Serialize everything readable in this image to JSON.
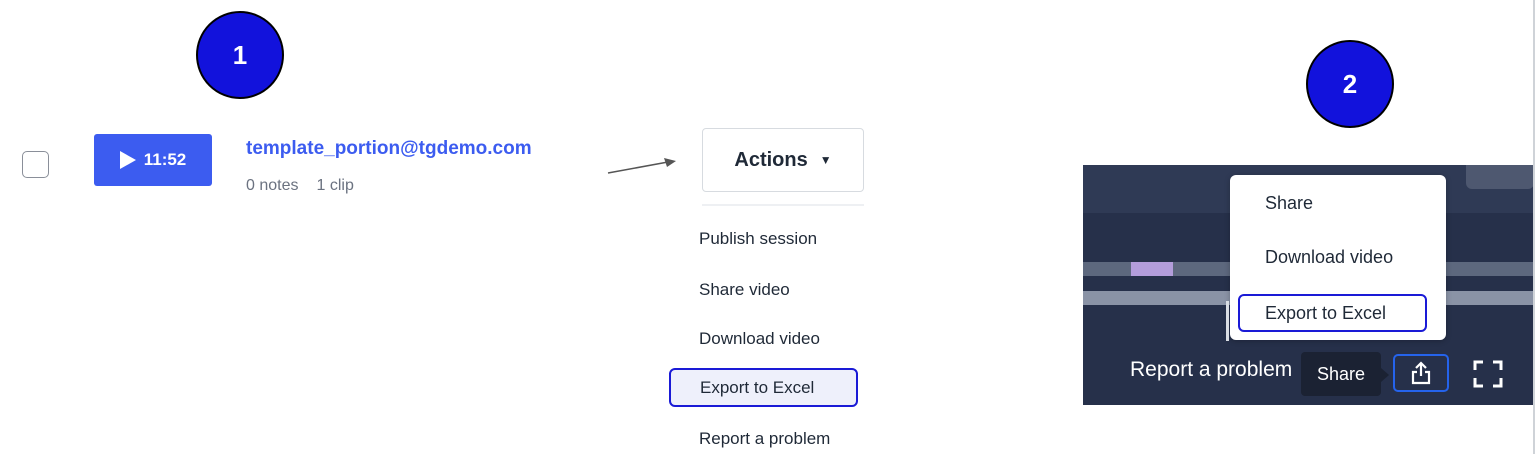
{
  "steps": {
    "one": "1",
    "two": "2"
  },
  "session": {
    "duration": "11:52",
    "email": "template_portion@tgdemo.com",
    "notes": "0 notes",
    "clips": "1 clip"
  },
  "actions": {
    "label": "Actions",
    "caret": "▼",
    "items": [
      "Publish session",
      "Share video",
      "Download video",
      "Export to Excel",
      "Report a problem"
    ]
  },
  "player": {
    "report_text": "Report a problem",
    "tooltip": "Share",
    "menu": [
      "Share",
      "Download video",
      "Export to Excel"
    ]
  },
  "colors": {
    "accent": "#3c5cf0",
    "highlight_border": "#1a1ad6",
    "badge": "#1212dc",
    "player_bg": "#26304a"
  }
}
